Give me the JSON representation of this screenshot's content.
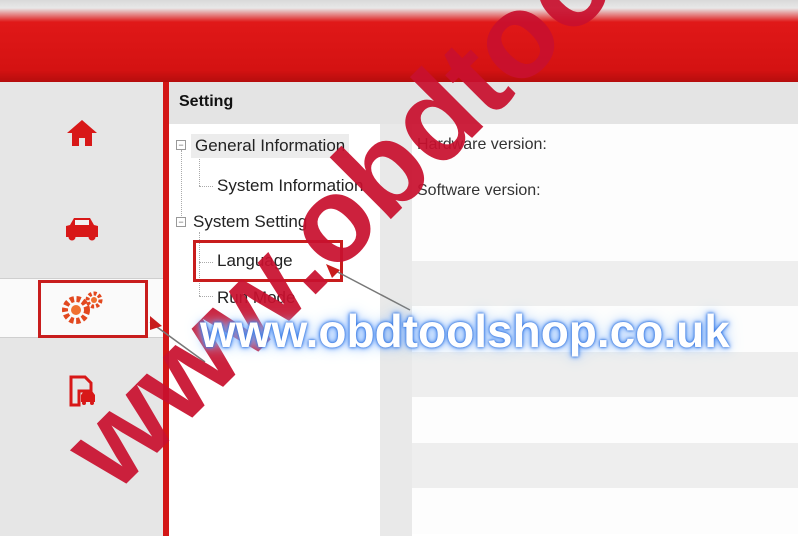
{
  "header": {
    "title": "Setting"
  },
  "sidebar": {
    "items": [
      {
        "icon": "home-icon"
      },
      {
        "icon": "car-icon"
      },
      {
        "icon": "settings-gears-icon",
        "active": true
      },
      {
        "icon": "vehicle-report-icon"
      }
    ]
  },
  "tree": {
    "general_information": "General Information",
    "system_information": "System Information",
    "system_setting": "System Setting",
    "language": "Language",
    "run_mode": "Run Mode"
  },
  "details": {
    "hardware_label": "Hardware version:",
    "software_label": "Software version:"
  },
  "watermark": {
    "text": "www.obdtoolshop.co.uk",
    "diagonal": "www.obdtool"
  },
  "colors": {
    "accent_red": "#d31616",
    "highlight_border": "#c81d1d",
    "watermark_glow": "#3b7fe8"
  }
}
